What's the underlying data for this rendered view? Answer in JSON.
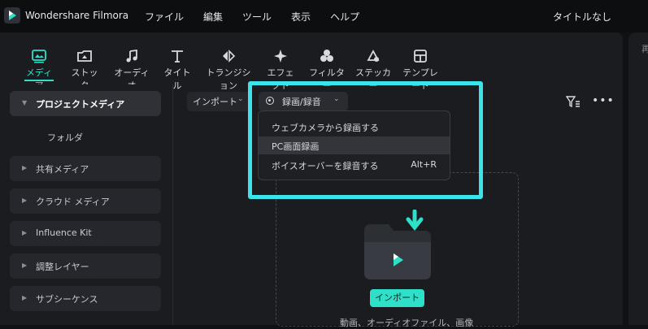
{
  "app": {
    "title": "Wondershare Filmora",
    "document_title": "タイトルなし"
  },
  "menu": [
    "ファイル",
    "編集",
    "ツール",
    "表示",
    "ヘルプ"
  ],
  "toolbar": {
    "items": [
      {
        "label": "メディア",
        "icon": "media-icon",
        "active": true
      },
      {
        "label": "ストック",
        "icon": "stock-icon"
      },
      {
        "label": "オーディオ",
        "icon": "music-note-icon"
      },
      {
        "label": "タイトル",
        "icon": "text-icon"
      },
      {
        "label": "トランジション",
        "icon": "transition-icon"
      },
      {
        "label": "エフェクト",
        "icon": "effect-sparkle-icon"
      },
      {
        "label": "フィルター",
        "icon": "filter-circles-icon"
      },
      {
        "label": "ステッカー",
        "icon": "sticker-icon"
      },
      {
        "label": "テンプレート",
        "icon": "template-icon"
      }
    ]
  },
  "sidebar": {
    "items": [
      {
        "label": "プロジェクトメディア",
        "expanded": true
      },
      {
        "label": "共有メディア"
      },
      {
        "label": "クラウド メディア"
      },
      {
        "label": "Influence Kit"
      },
      {
        "label": "調整レイヤー"
      },
      {
        "label": "サブシーケンス"
      }
    ],
    "subitem": "フォルダ"
  },
  "content": {
    "import_button": "インポート",
    "record_button": "録画/録音",
    "dropdown": [
      {
        "label": "ウェブカメラから録画する",
        "shortcut": ""
      },
      {
        "label": "PC画面録画",
        "shortcut": ""
      },
      {
        "label": "ボイスオーバーを録音する",
        "shortcut": "Alt+R"
      }
    ],
    "import_main_button": "インポート",
    "drop_hint": "動画、オーディオファイル、画像"
  },
  "right_panel": {
    "label": "再"
  },
  "colors": {
    "accent": "#2ee0c7",
    "highlight": "#3ce3ea",
    "background": "#1b1c20"
  }
}
